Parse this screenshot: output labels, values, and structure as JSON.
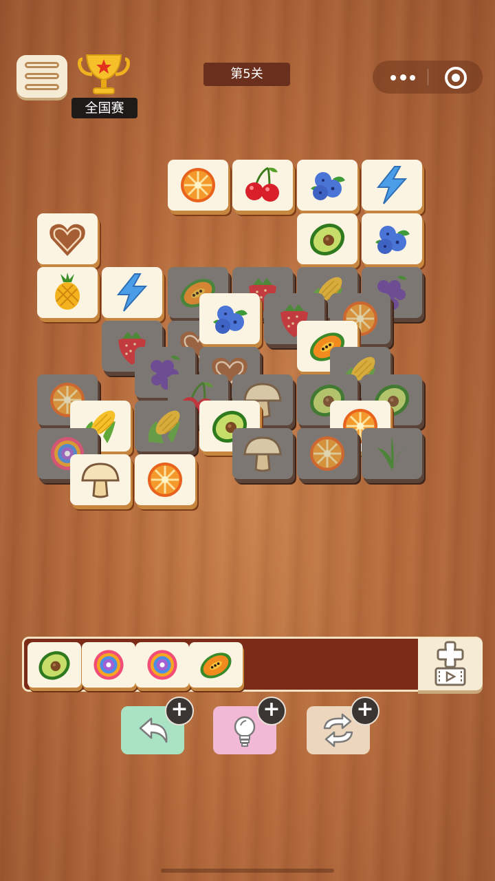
{
  "header": {
    "level_label": "第5关",
    "trophy_label": "全国赛"
  },
  "icons": {
    "menu": "menu-list-icon",
    "trophy": "trophy-icon",
    "more": "more-dots-icon",
    "target": "target-icon"
  },
  "board": {
    "tiles": [
      {
        "fruit": "orange",
        "state": "active"
      },
      {
        "fruit": "cherry",
        "state": "active"
      },
      {
        "fruit": "blueberry",
        "state": "active"
      },
      {
        "fruit": "lightning",
        "state": "active"
      },
      {
        "fruit": "avocado",
        "state": "active"
      },
      {
        "fruit": "blueberry",
        "state": "active"
      },
      {
        "fruit": "heart-cookie",
        "state": "active"
      },
      {
        "fruit": "pineapple",
        "state": "active"
      },
      {
        "fruit": "lightning",
        "state": "active"
      },
      {
        "fruit": "papaya",
        "state": "blocked"
      },
      {
        "fruit": "strawberry",
        "state": "blocked"
      },
      {
        "fruit": "corn",
        "state": "blocked"
      },
      {
        "fruit": "grape",
        "state": "blocked"
      },
      {
        "fruit": "strawberry",
        "state": "blocked"
      },
      {
        "fruit": "heart-cookie",
        "state": "blocked"
      },
      {
        "fruit": "blueberry",
        "state": "active"
      },
      {
        "fruit": "strawberry",
        "state": "blocked"
      },
      {
        "fruit": "orange",
        "state": "blocked"
      },
      {
        "fruit": "grape",
        "state": "blocked"
      },
      {
        "fruit": "heart-cookie",
        "state": "blocked"
      },
      {
        "fruit": "papaya",
        "state": "active"
      },
      {
        "fruit": "corn",
        "state": "blocked"
      },
      {
        "fruit": "orange",
        "state": "blocked"
      },
      {
        "fruit": "cherry",
        "state": "blocked"
      },
      {
        "fruit": "mushroom",
        "state": "blocked"
      },
      {
        "fruit": "avocado",
        "state": "blocked"
      },
      {
        "fruit": "avocado",
        "state": "blocked"
      },
      {
        "fruit": "corn",
        "state": "active"
      },
      {
        "fruit": "corn",
        "state": "blocked"
      },
      {
        "fruit": "avocado",
        "state": "active"
      },
      {
        "fruit": "orange",
        "state": "active"
      },
      {
        "fruit": "candy",
        "state": "blocked"
      },
      {
        "fruit": "mushroom",
        "state": "blocked"
      },
      {
        "fruit": "orange",
        "state": "blocked"
      },
      {
        "fruit": "herb",
        "state": "blocked"
      },
      {
        "fruit": "mushroom",
        "state": "active"
      },
      {
        "fruit": "orange",
        "state": "active"
      }
    ]
  },
  "tray": {
    "slots": [
      "avocado",
      "candy",
      "candy",
      "papaya"
    ],
    "capacity": 7,
    "add_slot_icon": "add-video-icon"
  },
  "tools": [
    {
      "name": "undo",
      "icon": "undo-arrow-icon",
      "color": "#a9e3c3"
    },
    {
      "name": "hint",
      "icon": "lightbulb-icon",
      "color": "#f2b9d6"
    },
    {
      "name": "shuffle",
      "icon": "shuffle-icon",
      "color": "#ecd6be"
    }
  ]
}
